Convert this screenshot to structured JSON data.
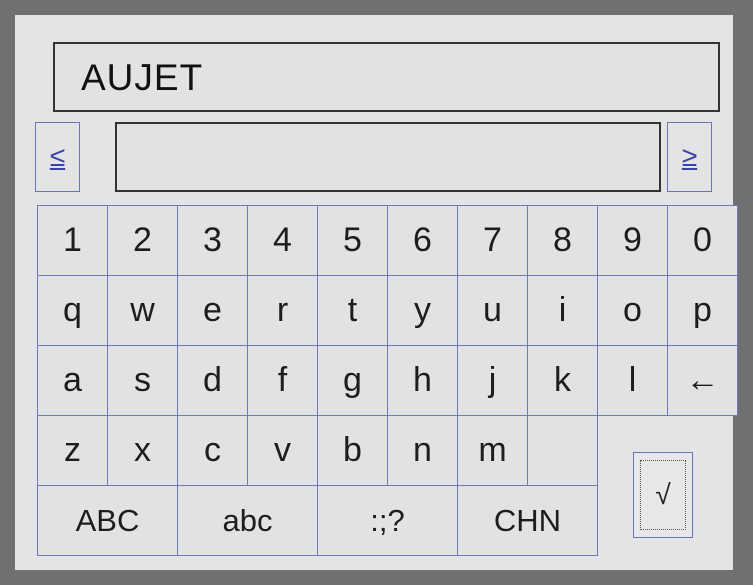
{
  "input": {
    "value": "AUJET"
  },
  "nav": {
    "prev_label": "≤",
    "next_label": "≥"
  },
  "candidates": {
    "value": ""
  },
  "keys": {
    "row1": [
      "1",
      "2",
      "3",
      "4",
      "5",
      "6",
      "7",
      "8",
      "9",
      "0"
    ],
    "row2": [
      "q",
      "w",
      "e",
      "r",
      "t",
      "y",
      "u",
      "i",
      "o",
      "p"
    ],
    "row3": [
      "a",
      "s",
      "d",
      "f",
      "g",
      "h",
      "j",
      "k",
      "l",
      "←"
    ],
    "row4": [
      "z",
      "x",
      "c",
      "v",
      "b",
      "n",
      "m",
      ""
    ],
    "row5": [
      "ABC",
      "abc",
      ":;?",
      "CHN"
    ]
  },
  "enter": {
    "label": "√"
  }
}
